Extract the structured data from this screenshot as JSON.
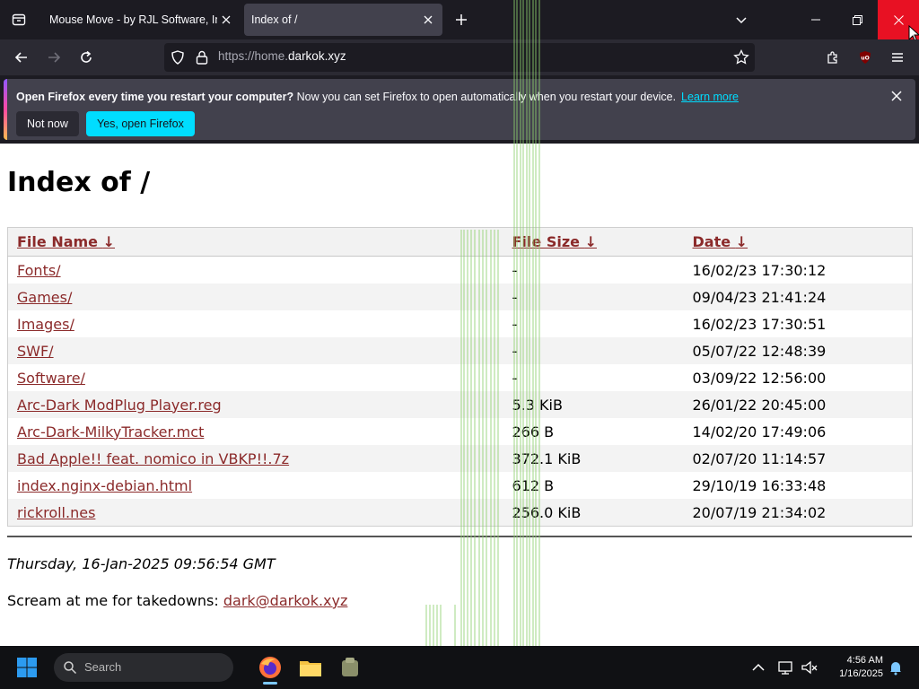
{
  "browser": {
    "tabs": [
      {
        "label": "Mouse Move - by RJL Software, Inc."
      },
      {
        "label": "Index of /"
      }
    ],
    "url": {
      "prefix": "https://home.",
      "domain": "darkok.xyz"
    },
    "accent": "#00ddff"
  },
  "notification": {
    "bold": "Open Firefox every time you restart your computer?",
    "message": "Now you can set Firefox to open automatically when you restart your device.",
    "link": "Learn more",
    "not_now": "Not now",
    "yes": "Yes, open Firefox"
  },
  "page": {
    "title": "Index of /",
    "columns": [
      "File Name",
      "File Size",
      "Date"
    ],
    "sort_indicator": "↓",
    "rows": [
      {
        "name": "Fonts/",
        "size": "-",
        "date": "16/02/23 17:30:12"
      },
      {
        "name": "Games/",
        "size": "-",
        "date": "09/04/23 21:41:24"
      },
      {
        "name": "Images/",
        "size": "-",
        "date": "16/02/23 17:30:51"
      },
      {
        "name": "SWF/",
        "size": "-",
        "date": "05/07/22 12:48:39"
      },
      {
        "name": "Software/",
        "size": "-",
        "date": "03/09/22 12:56:00"
      },
      {
        "name": "Arc-Dark ModPlug Player.reg",
        "size": "5.3 KiB",
        "date": "26/01/22 20:45:00"
      },
      {
        "name": "Arc-Dark-MilkyTracker.mct",
        "size": "266 B",
        "date": "14/02/20 17:49:06"
      },
      {
        "name": "Bad Apple!! feat. nomico in VBKP!!.7z",
        "size": "372.1 KiB",
        "date": "02/07/20 11:14:57"
      },
      {
        "name": "index.nginx-debian.html",
        "size": "612 B",
        "date": "29/10/19 16:33:48"
      },
      {
        "name": "rickroll.nes",
        "size": "256.0 KiB",
        "date": "20/07/19 21:34:02"
      }
    ],
    "footer_date": "Thursday, 16-Jan-2025 09:56:54 GMT",
    "contact_label": "Scream at me for takedowns:",
    "contact_email": "dark@darkok.xyz",
    "link_color": "#8b2a2a"
  },
  "taskbar": {
    "search_placeholder": "Search",
    "time": "4:56 AM",
    "date": "1/16/2025"
  }
}
